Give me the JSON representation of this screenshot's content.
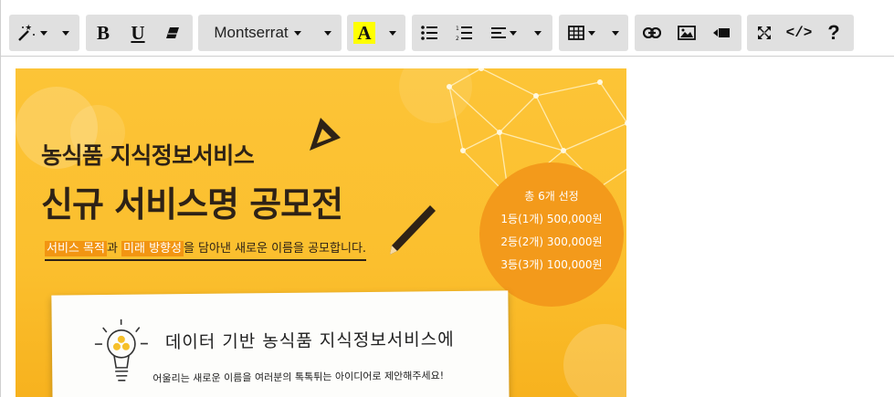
{
  "toolbar": {
    "font_name": "Montserrat",
    "forecolor_letter": "A",
    "highlight_color": "#ffff00",
    "bold_label": "B",
    "underline_label": "U",
    "codeview_label": "</>",
    "help_label": "?",
    "icons": [
      "magic-icon",
      "eraser-icon",
      "unordered-list-icon",
      "ordered-list-icon",
      "align-left-icon",
      "table-icon",
      "link-icon",
      "picture-icon",
      "video-icon",
      "fullscreen-icon"
    ]
  },
  "content": {
    "headline_1": "농식품 지식정보서비스",
    "headline_2": "신규 서비스명 공모전",
    "subtitle": {
      "highlight_1": "서비스 목적",
      "part_1": "과 ",
      "highlight_2": "미래 방향성",
      "part_2": "을 담아낸 새로운 이름을 공모합니다."
    },
    "prize_lines": [
      "총 6개 선정",
      "1등(1개) 500,000원",
      "2등(2개) 300,000원",
      "3등(3개) 100,000원"
    ],
    "paper_title": "데이터 기반 농식품 지식정보서비스에",
    "paper_subtitle": "어울리는 새로운 이름을 여러분의 톡톡튀는 아이디어로 제안해주세요!",
    "colors": {
      "background": "#fcc437",
      "prize_circle": "#f39a1b",
      "text_dark": "#2e2216",
      "highlight": "#f29512"
    }
  }
}
